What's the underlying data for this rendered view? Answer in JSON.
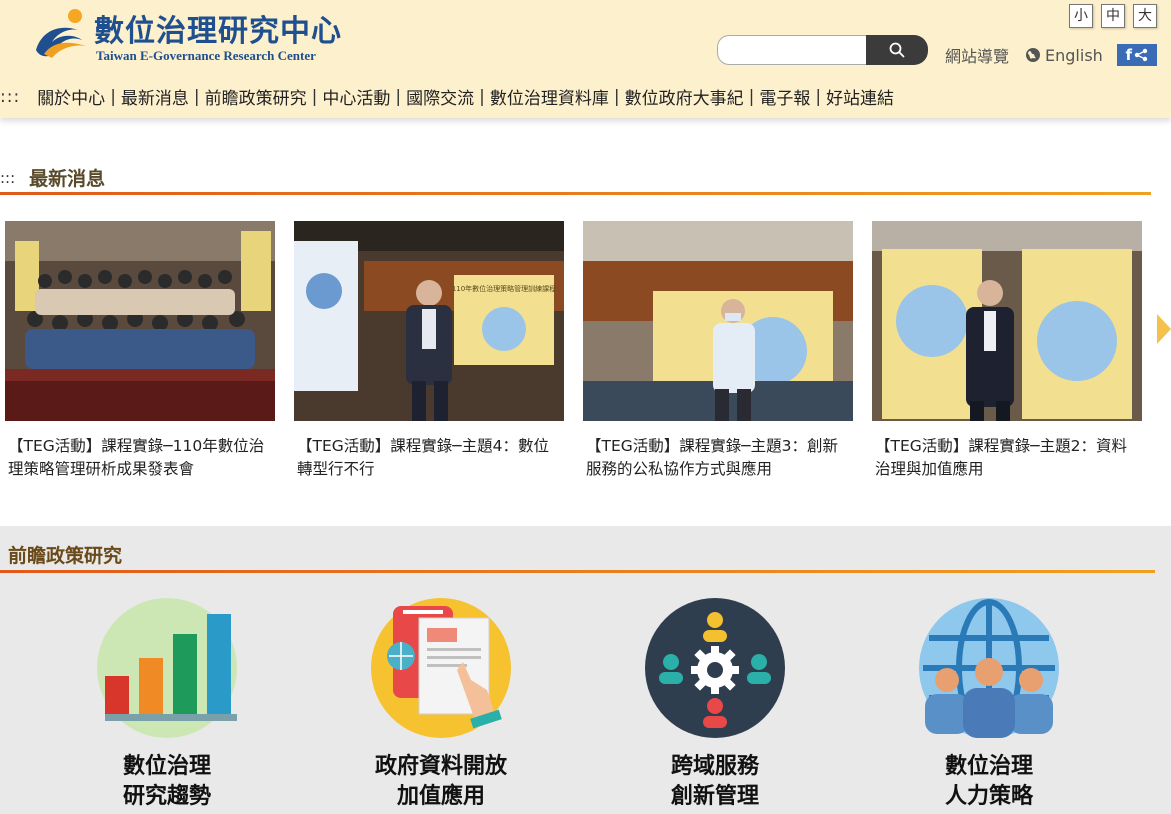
{
  "header": {
    "title": "數位治理研究中心",
    "subtitle": "Taiwan E-Governance Research Center",
    "font_sizes": [
      "小",
      "中",
      "大"
    ],
    "search": {
      "placeholder": "",
      "value": ""
    },
    "sitemap_label": "網站導覽",
    "language_label": "English",
    "share_label": "f"
  },
  "nav": {
    "marker": ":::",
    "items": [
      "關於中心",
      "最新消息",
      "前瞻政策研究",
      "中心活動",
      "國際交流",
      "數位治理資料庫",
      "數位政府大事紀",
      "電子報",
      "好站連結"
    ]
  },
  "news": {
    "marker": ":::",
    "title": "最新消息",
    "items": [
      {
        "title": "【TEG活動】課程實錄─110年數位治理策略管理研析成果發表會"
      },
      {
        "title": "【TEG活動】課程實錄─主題4：數位轉型行不行"
      },
      {
        "title": "【TEG活動】課程實錄─主題3：創新服務的公私協作方式與應用"
      },
      {
        "title": "【TEG活動】課程實錄─主題2：資料治理與加值應用"
      }
    ],
    "slide_banner": "110年數位治理策略管理訓練課程"
  },
  "research": {
    "title": "前瞻政策研究",
    "items": [
      {
        "line1": "數位治理",
        "line2": "研究趨勢",
        "icon": "bar-chart-icon"
      },
      {
        "line1": "政府資料開放",
        "line2": "加值應用",
        "icon": "open-data-icon"
      },
      {
        "line1": "跨域服務",
        "line2": "創新管理",
        "icon": "collaboration-icon"
      },
      {
        "line1": "數位治理",
        "line2": "人力策略",
        "icon": "workforce-icon"
      }
    ]
  },
  "colors": {
    "header_bg": "#fdf0cc",
    "brand_blue": "#1f4f8f",
    "accent_orange": "#e05a1a",
    "section_gray": "#e9e9e9"
  }
}
